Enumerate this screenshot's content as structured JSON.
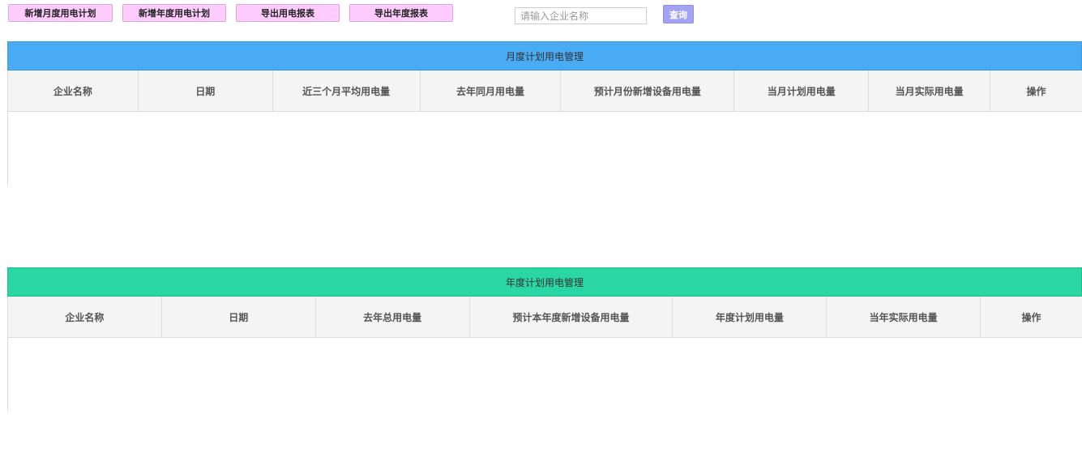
{
  "toolbar": {
    "add_monthly": "新增月度用电计划",
    "add_annual": "新增年度用电计划",
    "export_power": "导出用电报表",
    "export_annual": "导出年度报表",
    "search_placeholder": "请输入企业名称",
    "search_value": "",
    "query_label": "查询"
  },
  "monthly": {
    "title": "月度计划用电管理",
    "columns": [
      "企业名称",
      "日期",
      "近三个月平均用电量",
      "去年同月用电量",
      "预计月份新增设备用电量",
      "当月计划用电量",
      "当月实际用电量",
      "操作"
    ],
    "rows": []
  },
  "annual": {
    "title": "年度计划用电管理",
    "columns": [
      "企业名称",
      "日期",
      "去年总用电量",
      "预计本年度新增设备用电量",
      "年度计划用电量",
      "当年实际用电量",
      "操作"
    ],
    "rows": []
  }
}
